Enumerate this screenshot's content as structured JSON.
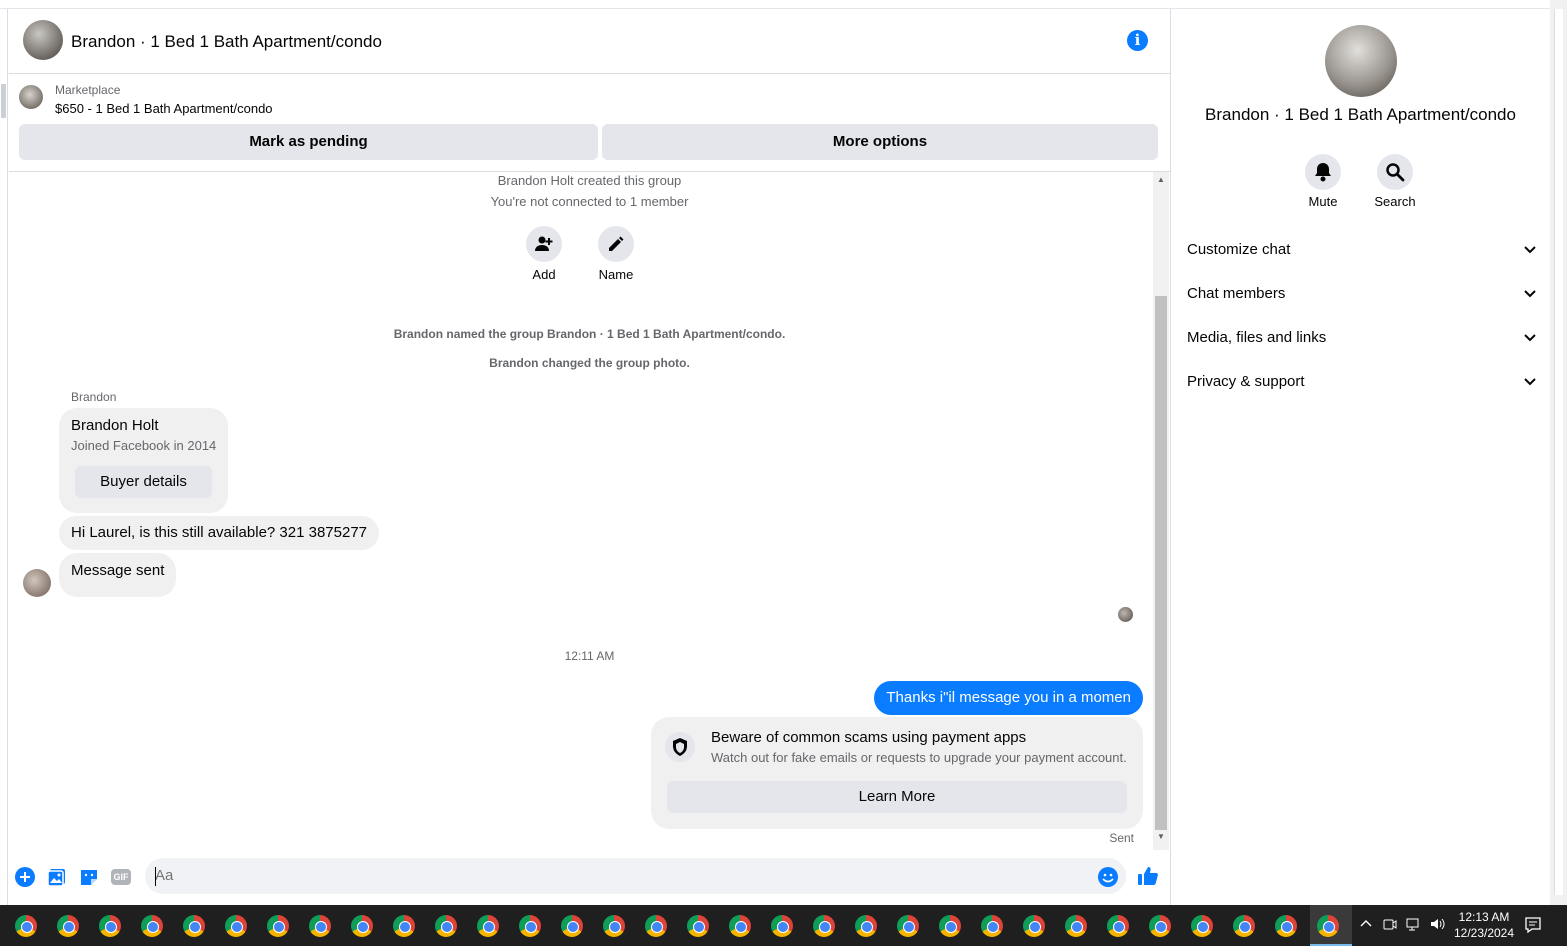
{
  "header": {
    "title": "Brandon · 1 Bed 1 Bath Apartment/condo"
  },
  "marketplace": {
    "label": "Marketplace",
    "listing": "$650 - 1 Bed 1 Bath Apartment/condo",
    "pending_button": "Mark as pending",
    "more_button": "More options"
  },
  "chat": {
    "created": "Brandon Holt created this group",
    "not_connected": "You're not connected to 1 member",
    "add_label": "Add",
    "name_label": "Name",
    "named_group": "Brandon named the group Brandon · 1 Bed 1 Bath Apartment/condo.",
    "changed_photo": "Brandon changed the group photo.",
    "sender": "Brandon",
    "profile_name": "Brandon Holt",
    "profile_joined": "Joined Facebook in 2014",
    "buyer_details": "Buyer details",
    "message_1": "Hi Laurel, is this still available? 321 3875277",
    "message_2": "Message sent",
    "timestamp": "12:11 AM",
    "outgoing": "Thanks i\"il message you in a momen",
    "scam_title": "Beware of common scams using payment apps",
    "scam_sub": "Watch out for fake emails or requests to upgrade your payment account.",
    "learn_more": "Learn More",
    "sent": "Sent"
  },
  "composer": {
    "placeholder": "Aa",
    "gif": "GIF"
  },
  "panel": {
    "title": "Brandon · 1 Bed 1 Bath Apartment/condo",
    "mute": "Mute",
    "search": "Search",
    "sections": [
      "Customize chat",
      "Chat members",
      "Media, files and links",
      "Privacy & support"
    ]
  },
  "taskbar": {
    "time": "12:13 AM",
    "date": "12/23/2024"
  },
  "colors": {
    "accent": "#0a7cff",
    "bubble_in": "#f0f0f0",
    "button_gray": "#e4e6eb"
  }
}
